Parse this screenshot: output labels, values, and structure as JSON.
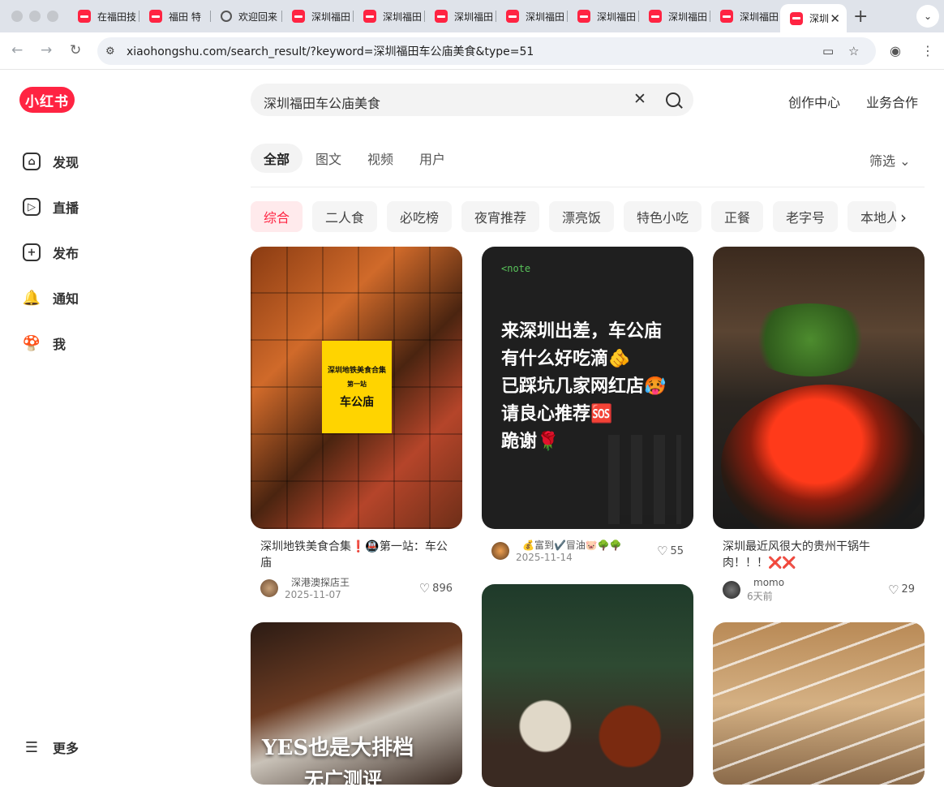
{
  "browser": {
    "tabs": [
      {
        "title": "在福田技"
      },
      {
        "title": "福田 特"
      },
      {
        "title": "欢迎回来"
      },
      {
        "title": "深圳福田"
      },
      {
        "title": "深圳福田"
      },
      {
        "title": "深圳福田"
      },
      {
        "title": "深圳福田"
      },
      {
        "title": "深圳福田"
      },
      {
        "title": "深圳福田"
      },
      {
        "title": "深圳福田"
      },
      {
        "title": "深圳"
      }
    ],
    "url": "xiaohongshu.com/search_result/?keyword=深圳福田车公庙美食&type=51"
  },
  "brand": {
    "logo_text": "小红书",
    "color": "#ff2442"
  },
  "sidebar": {
    "items": [
      {
        "label": "发现",
        "icon": "home-icon"
      },
      {
        "label": "直播",
        "icon": "live-icon"
      },
      {
        "label": "发布",
        "icon": "plus-icon"
      },
      {
        "label": "通知",
        "icon": "bell-icon"
      },
      {
        "label": "我",
        "icon": "avatar-icon"
      }
    ],
    "more_label": "更多"
  },
  "header": {
    "search_value": "深圳福田车公庙美食",
    "links": [
      "创作中心",
      "业务合作"
    ]
  },
  "type_tabs": [
    "全部",
    "图文",
    "视频",
    "用户"
  ],
  "filter_label": "筛选",
  "chips": [
    "综合",
    "二人食",
    "必吃榜",
    "夜宵推荐",
    "漂亮饭",
    "特色小吃",
    "正餐",
    "老字号",
    "本地人"
  ],
  "cards": [
    {
      "title": "深圳地铁美食合集❗🚇第一站：车公庙",
      "author": "深港澳探店王",
      "date": "2025-11-07",
      "likes": "896",
      "cover_text": {
        "l1": "深圳地铁美食合集",
        "l2": "第一站",
        "l3": "车公庙"
      }
    },
    {
      "title": "",
      "author": "💰富到✔️冒油🐷🌳🌳",
      "date": "2025-11-14",
      "likes": "55",
      "cover_text": {
        "tag": "<note",
        "lines": [
          "来深圳出差，车公庙",
          "有什么好吃滴🫵",
          "已踩坑几家网红店🥵",
          "请良心推荐🆘",
          "跪谢🌹"
        ]
      }
    },
    {
      "title": "深圳最近风很大的贵州干锅牛肉！！！❌❌",
      "author": "momo",
      "date": "6天前",
      "likes": "29"
    },
    {
      "cover_text": {
        "l1": "YES也是大排档",
        "l2": "无广测评"
      }
    },
    {},
    {}
  ]
}
